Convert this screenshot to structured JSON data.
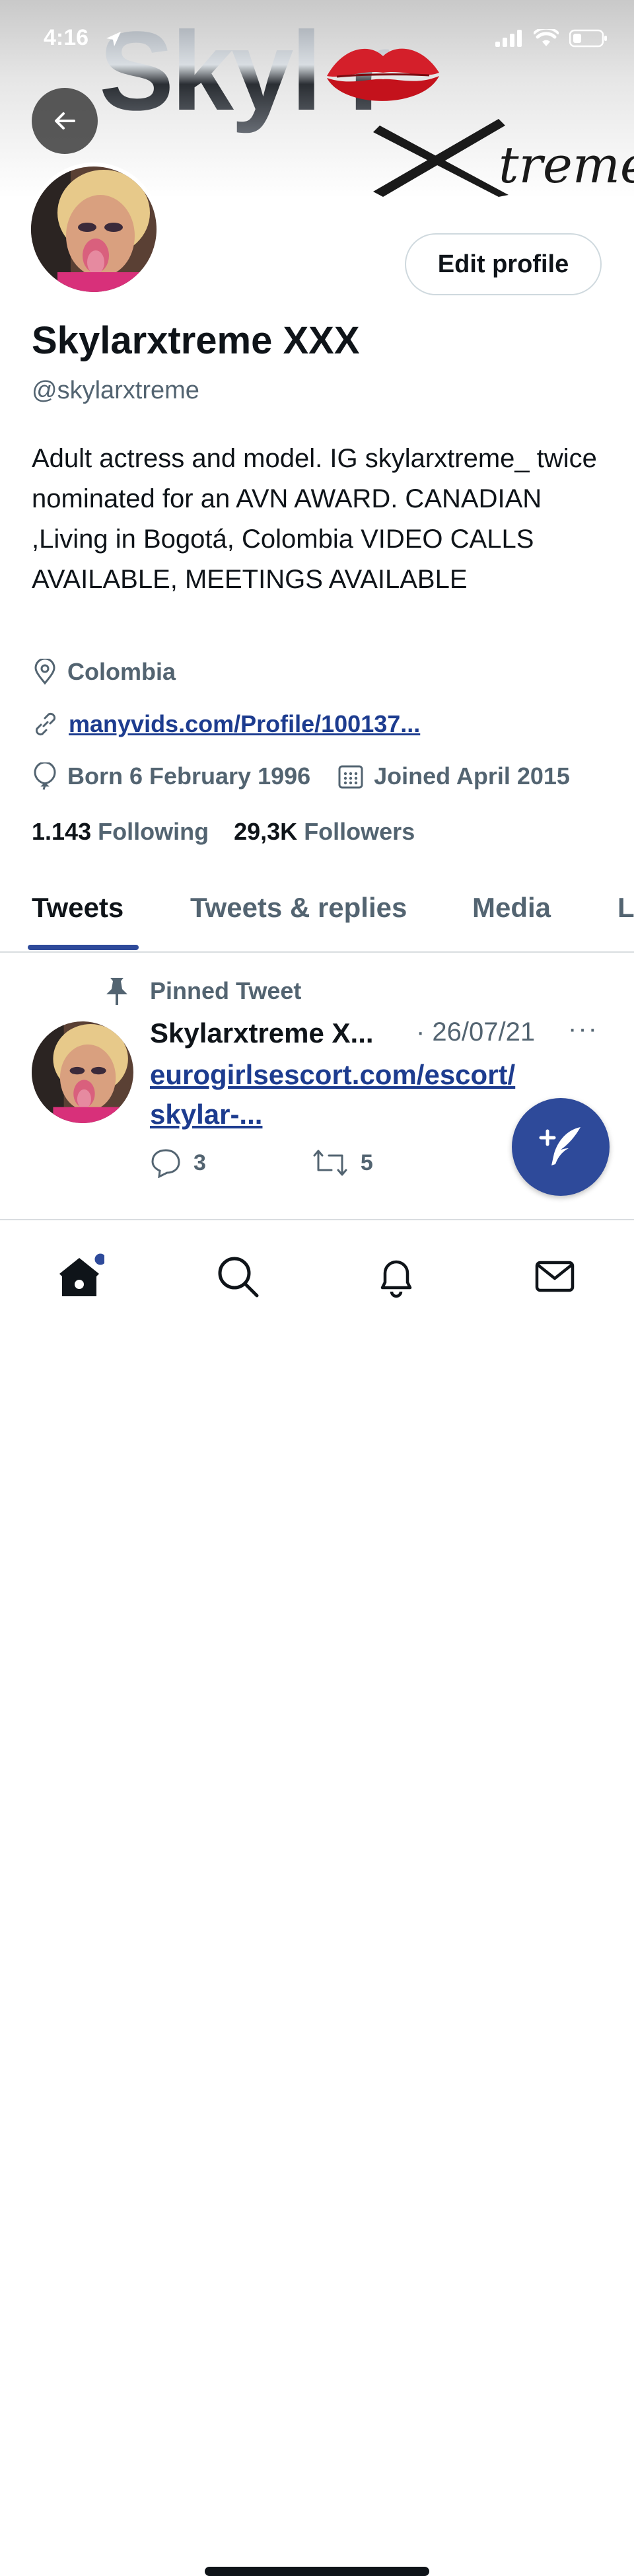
{
  "status_bar": {
    "time": "4:16"
  },
  "banner": {
    "logo_text": "Skyl r",
    "xtreme_text": "treme"
  },
  "profile": {
    "name": "Skylarxtreme XXX",
    "handle": "@skylarxtreme",
    "bio": "Adult actress and model. IG skylarxtreme_ twice nominated for an AVN AWARD. CANADIAN ,Living in Bogotá, Colombia VIDEO CALLS AVAILABLE, MEETINGS AVAILABLE",
    "location": "Colombia",
    "website": "manyvids.com/Profile/100137...",
    "born": "Born 6 February 1996",
    "joined": "Joined April 2015",
    "following_count": "1.143",
    "following_label": "Following",
    "followers_count": "29,3K",
    "followers_label": "Followers",
    "edit_button": "Edit profile"
  },
  "tabs": [
    "Tweets",
    "Tweets & replies",
    "Media",
    "L"
  ],
  "pinned_tweet": {
    "pinned_label": "Pinned Tweet",
    "author": "Skylarxtreme X...",
    "date": "· 26/07/21",
    "more": "···",
    "link": "eurogirlsescort.com/escort/ skylar-...",
    "replies": "3",
    "retweets": "5"
  },
  "colors": {
    "accent": "#2e4a9a",
    "link": "#1d3c8f",
    "muted": "#536471",
    "text": "#0f1419"
  },
  "icons": [
    "back-arrow-icon",
    "location-pin-icon",
    "link-icon",
    "birthday-balloon-icon",
    "calendar-icon",
    "pin-icon",
    "reply-icon",
    "retweet-icon",
    "compose-icon",
    "home-icon",
    "search-icon",
    "bell-icon",
    "mail-icon"
  ]
}
